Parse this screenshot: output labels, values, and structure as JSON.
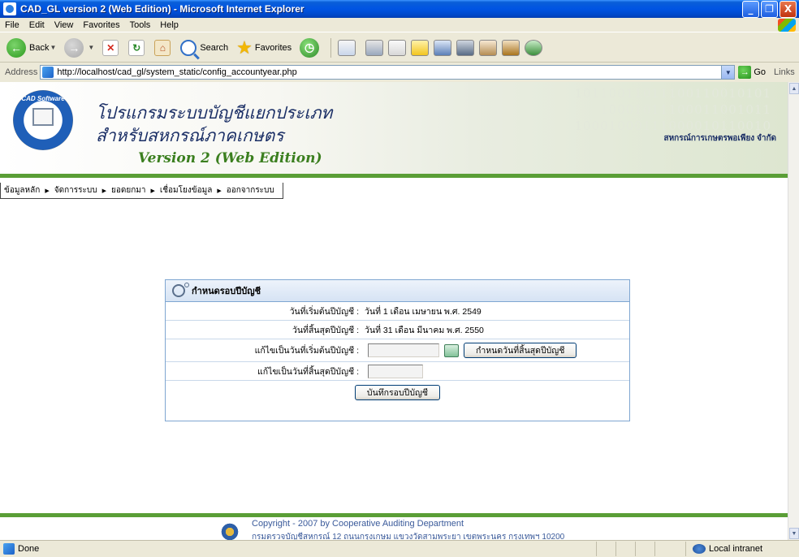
{
  "window": {
    "title": "CAD_GL version 2 (Web Edition) - Microsoft Internet Explorer",
    "minimize": "_",
    "maximize": "❐",
    "close": "X"
  },
  "menubar": {
    "items": [
      "File",
      "Edit",
      "View",
      "Favorites",
      "Tools",
      "Help"
    ]
  },
  "toolbar": {
    "back_label": "Back",
    "search_label": "Search",
    "favorites_label": "Favorites"
  },
  "addressbar": {
    "label": "Address",
    "url": "http://localhost/cad_gl/system_static/config_accountyear.php",
    "go_label": "Go",
    "links_label": "Links"
  },
  "banner": {
    "logo_text": "CAD Software Center",
    "title_line1": "โปรแกรมระบบบัญชีแยกประเภท",
    "title_line2": "สำหรับสหกรณ์ภาคเกษตร",
    "version": "Version 2 (Web Edition)",
    "org_name": "สหกรณ์การเกษตรพอเพียง จำกัด",
    "binary": [
      "10110011011100110010101",
      "10001011100011001011",
      "10001000111000010110010"
    ]
  },
  "navmenu": {
    "items": [
      "ข้อมูลหลัก",
      "จัดการระบบ",
      "ยอดยกมา",
      "เชื่อมโยงข้อมูล",
      "ออกจากระบบ"
    ]
  },
  "form": {
    "title": "กำหนดรอบปีบัญชี",
    "rows": [
      {
        "label": "วันที่เริ่มต้นปีบัญชี :",
        "value": "วันที่ 1 เดือน เมษายน พ.ศ. 2549"
      },
      {
        "label": "วันที่สิ้นสุดปีบัญชี :",
        "value": "วันที่ 31 เดือน มีนาคม พ.ศ. 2550"
      }
    ],
    "edit_start_label": "แก้ไขเป็นวันที่เริ่มต้นปีบัญชี :",
    "edit_start_value": "",
    "edit_end_label": "แก้ไขเป็นวันที่สิ้นสุดปีบัญชี :",
    "edit_end_value": "",
    "set_end_button": "กำหนดวันที่สิ้นสุดปีบัญชี",
    "save_button": "บันทึกรอบปีบัญชี"
  },
  "footer": {
    "copyright": "Copyright - 2007 by Cooperative Auditing Department",
    "address": "กรมตรวจบัญชีสหกรณ์ 12 ถนนกรุงเกษม แขวงวัดสามพระยา เขตพระนคร กรุงเทพฯ 10200"
  },
  "statusbar": {
    "text": "Done",
    "zone": "Local intranet"
  }
}
